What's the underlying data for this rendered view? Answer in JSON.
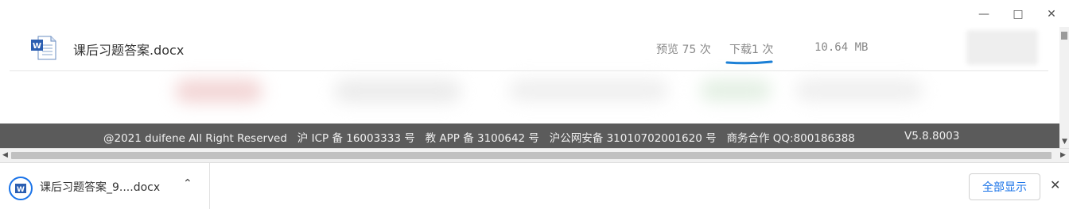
{
  "window": {
    "minimize_icon": "minimize-icon",
    "maximize_icon": "maximize-icon",
    "close_icon": "close-icon"
  },
  "file_row": {
    "name": "课后习题答案.docx",
    "preview": "预览 75 次",
    "download": "下载1 次",
    "size": "10.64 MB",
    "file_icon": "word-document-icon",
    "highlight_color": "#1a7fd6"
  },
  "footer": {
    "text": "@2021 duifene All Right Reserved   沪 ICP 备 16003333 号   教 APP 备 3100642 号   沪公网安备 31010702001620 号   商务合作 QQ:800186388",
    "version": "V5.8.8003",
    "background": "#5b5b5b"
  },
  "download_bar": {
    "item_name": "课后习题答案_9....docx",
    "show_all": "全部显示",
    "accent": "#1a73e8"
  }
}
